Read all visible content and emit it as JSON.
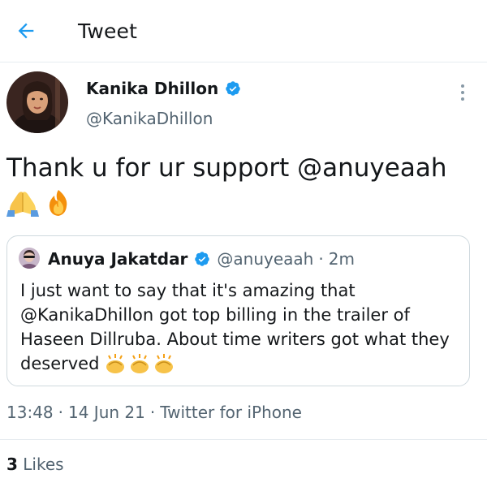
{
  "header": {
    "title": "Tweet"
  },
  "tweet": {
    "author_name": "Kanika Dhillon",
    "author_handle": "@KanikaDhillon",
    "text_prefix": "Thank u for ur support ",
    "mention": "@anuyeaah",
    "emojis": [
      "folded-hands",
      "fire"
    ]
  },
  "quote": {
    "author_name": "Anuya Jakatdar",
    "author_handle": "@anuyeaah",
    "separator": "·",
    "time": "2m",
    "text": "I just want to say that it's amazing that @KanikaDhillon got top billing in the trailer of Haseen Dillruba. About time writers got what they deserved",
    "emojis": [
      "clapping-hands",
      "clapping-hands",
      "clapping-hands"
    ]
  },
  "meta": {
    "time": "13:48",
    "sep1": "·",
    "date": "14 Jun 21",
    "sep2": "·",
    "source": "Twitter for iPhone"
  },
  "likes": {
    "count": "3",
    "label": "Likes"
  },
  "colors": {
    "accent": "#1d9bf0",
    "muted": "#536471",
    "text": "#14171a"
  }
}
